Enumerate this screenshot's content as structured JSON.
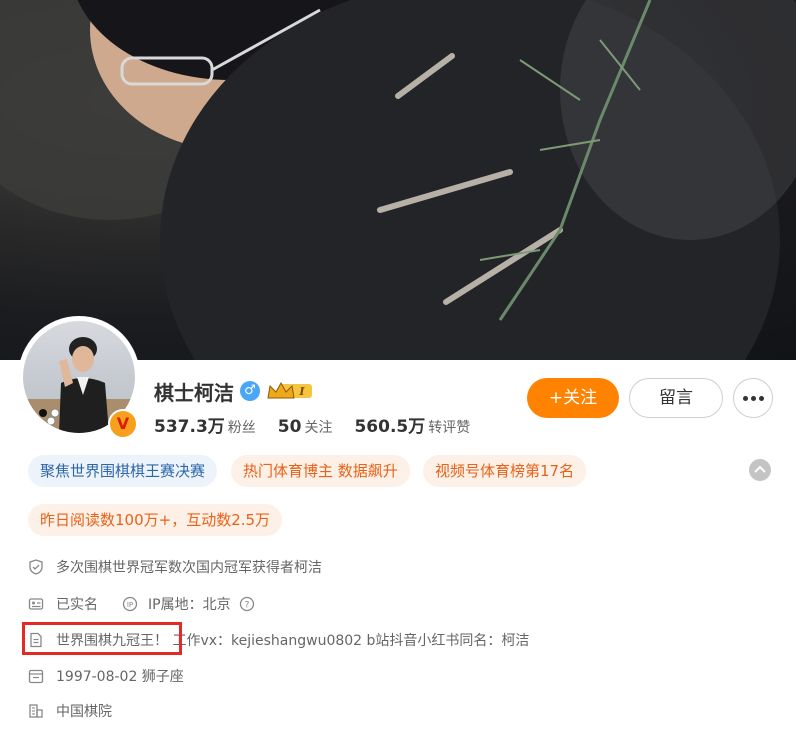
{
  "profile": {
    "name": "棋士柯洁",
    "stats": [
      {
        "value": "537.3万",
        "label": "粉丝"
      },
      {
        "value": "50",
        "label": "关注"
      },
      {
        "value": "560.5万",
        "label": "转评赞"
      }
    ],
    "vip_level": "I"
  },
  "actions": {
    "follow_label": "+关注",
    "message_label": "留言"
  },
  "tags": [
    {
      "text": "聚焦世界围棋棋王赛决赛"
    },
    {
      "text": "热门体育博主 数据飙升"
    },
    {
      "text": "视频号体育榜第17名"
    },
    {
      "text": "昨日阅读数100万+，互动数2.5万"
    }
  ],
  "info": {
    "verification": "多次围棋世界冠军数次国内冠军获得者柯洁",
    "real_name": "已实名",
    "ip_location": "IP属地：北京",
    "bio": "世界围棋九冠王！ 工作vx：kejieshangwu0802 b站抖音小红书同名：柯洁",
    "birthday": "1997-08-02 狮子座",
    "organization": "中国棋院"
  },
  "colors": {
    "follow_button": "#ff8200",
    "tag_blue_text": "#2d67a8",
    "tag_orange_text": "#e8621a",
    "highlight_box": "#e32a24",
    "gender_badge": "#4aa6f7"
  },
  "icons": {
    "gender": "male-icon",
    "vip": "crown-icon",
    "verified": "v-badge-icon",
    "more": "more-dots-icon"
  }
}
